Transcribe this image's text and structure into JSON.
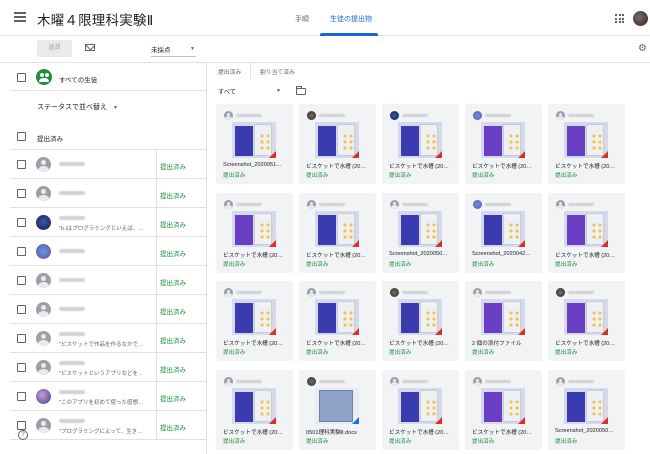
{
  "header": {
    "title": "木曜４限理科実験Ⅱ",
    "tabs": [
      {
        "label": "手順",
        "active": false
      },
      {
        "label": "生徒の提出物",
        "active": true
      }
    ]
  },
  "toolbar": {
    "return_label": "返却",
    "grade_filter": "未採点"
  },
  "left": {
    "all_students": "すべての生徒",
    "sort_label": "ステータスで並べ替え",
    "group_label": "提出済み",
    "students": [
      {
        "note": "",
        "status": "提出済み",
        "avatar": "default"
      },
      {
        "note": "",
        "status": "提出済み",
        "avatar": "default"
      },
      {
        "note": "\"b.iはプログラミングといえば、…",
        "status": "提出済み",
        "avatar": "photo1"
      },
      {
        "note": "",
        "status": "提出済み",
        "avatar": "photo2"
      },
      {
        "note": "",
        "status": "提出済み",
        "avatar": "default"
      },
      {
        "note": "",
        "status": "提出済み",
        "avatar": "default"
      },
      {
        "note": "\"ビスケットで作品を作るなかで…",
        "status": "提出済み",
        "avatar": "default"
      },
      {
        "note": "\"ビスケットというアプリなどを…",
        "status": "提出済み",
        "avatar": "default"
      },
      {
        "note": "\"このアプリを初めて使った感想…",
        "status": "提出済み",
        "avatar": "photo3"
      },
      {
        "note": "\"プログラミングによって、生き…",
        "status": "提出済み",
        "avatar": "default"
      }
    ]
  },
  "right": {
    "tabs": [
      "提出済み",
      "割り当て済み"
    ],
    "filter": "すべて",
    "cards": [
      {
        "file": "Screenshot_2020051…",
        "status": "提出済み",
        "avatar": "default",
        "thumb": "blue"
      },
      {
        "file": "ビスケットで水槽 (20…",
        "status": "提出済み",
        "avatar": "p3",
        "thumb": "blue"
      },
      {
        "file": "ビスケットで水槽 (20…",
        "status": "提出済み",
        "avatar": "p1",
        "thumb": "blue"
      },
      {
        "file": "ビスケットで水槽 (20…",
        "status": "提出済み",
        "avatar": "p2",
        "thumb": "purple"
      },
      {
        "file": "ビスケットで水槽 (20…",
        "status": "提出済み",
        "avatar": "default",
        "thumb": "purple"
      },
      {
        "file": "ビスケットで水槽 (20…",
        "status": "提出済み",
        "avatar": "default",
        "thumb": "purple"
      },
      {
        "file": "ビスケットで水槽 (20…",
        "status": "提出済み",
        "avatar": "default",
        "thumb": "blue"
      },
      {
        "file": "Screenshot_2020050…",
        "status": "提出済み",
        "avatar": "default",
        "thumb": "blue"
      },
      {
        "file": "Screenshot_2020042…",
        "status": "提出済み",
        "avatar": "p2",
        "thumb": "blue"
      },
      {
        "file": "ビスケットで水槽 (20…",
        "status": "提出済み",
        "avatar": "default",
        "thumb": "purple"
      },
      {
        "file": "ビスケットで水槽 (20…",
        "status": "提出済み",
        "avatar": "default",
        "thumb": "blue"
      },
      {
        "file": "ビスケットで水槽 (20…",
        "status": "提出済み",
        "avatar": "default",
        "thumb": "blue"
      },
      {
        "file": "ビスケットで水槽 (20…",
        "status": "提出済み",
        "avatar": "p3",
        "thumb": "blue"
      },
      {
        "file": "2 個の添付ファイル",
        "status": "提出済み",
        "avatar": "default",
        "thumb": "purple"
      },
      {
        "file": "ビスケットで水槽 (20…",
        "status": "提出済み",
        "avatar": "p3",
        "thumb": "purple"
      },
      {
        "file": "ビスケットで水槽 (20…",
        "status": "提出済み",
        "avatar": "default",
        "thumb": "blue"
      },
      {
        "file": "0501理科実験Ⅱ.docx",
        "status": "提出済み",
        "avatar": "p3",
        "thumb": "doc"
      },
      {
        "file": "ビスケットで水槽 (20…",
        "status": "提出済み",
        "avatar": "default",
        "thumb": "blue"
      },
      {
        "file": "ビスケットで水槽 (20…",
        "status": "提出済み",
        "avatar": "default",
        "thumb": "purple"
      },
      {
        "file": "Screenshot_2020050…",
        "status": "提出済み",
        "avatar": "default",
        "thumb": "blue"
      }
    ]
  },
  "colors": {
    "accent": "#1967d2",
    "submitted": "#1e8e3e"
  },
  "icons": [
    "menu-icon",
    "mail-icon",
    "apps-icon",
    "gear-icon",
    "folder-icon",
    "help-icon",
    "people-icon"
  ]
}
